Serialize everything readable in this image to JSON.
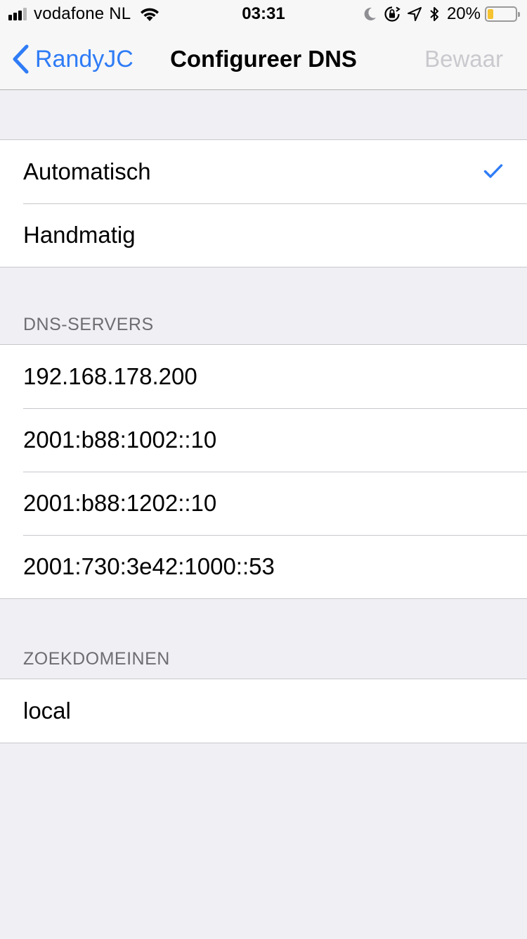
{
  "status_bar": {
    "carrier": "vodafone NL",
    "time": "03:31",
    "battery_percent": "20%",
    "battery_level": 0.2,
    "signal_bars": 3,
    "icons": [
      "signal-icon",
      "wifi-icon",
      "moon-icon",
      "rotation-lock-icon",
      "location-icon",
      "bluetooth-icon",
      "battery-icon"
    ]
  },
  "nav": {
    "back_label": "RandyJC",
    "title": "Configureer DNS",
    "save_label": "Bewaar"
  },
  "mode": {
    "options": [
      {
        "label": "Automatisch",
        "selected": true
      },
      {
        "label": "Handmatig",
        "selected": false
      }
    ]
  },
  "dns": {
    "header": "DNS-SERVERS",
    "servers": [
      "192.168.178.200",
      "2001:b88:1002::10",
      "2001:b88:1202::10",
      "2001:730:3e42:1000::53"
    ]
  },
  "search_domains": {
    "header": "ZOEKDOMEINEN",
    "items": [
      "local"
    ]
  },
  "colors": {
    "accent": "#2f7cf6",
    "background": "#efeff4",
    "disabled": "#c9c9ce",
    "section_header": "#6d6d72",
    "battery_low": "#f5c230"
  }
}
